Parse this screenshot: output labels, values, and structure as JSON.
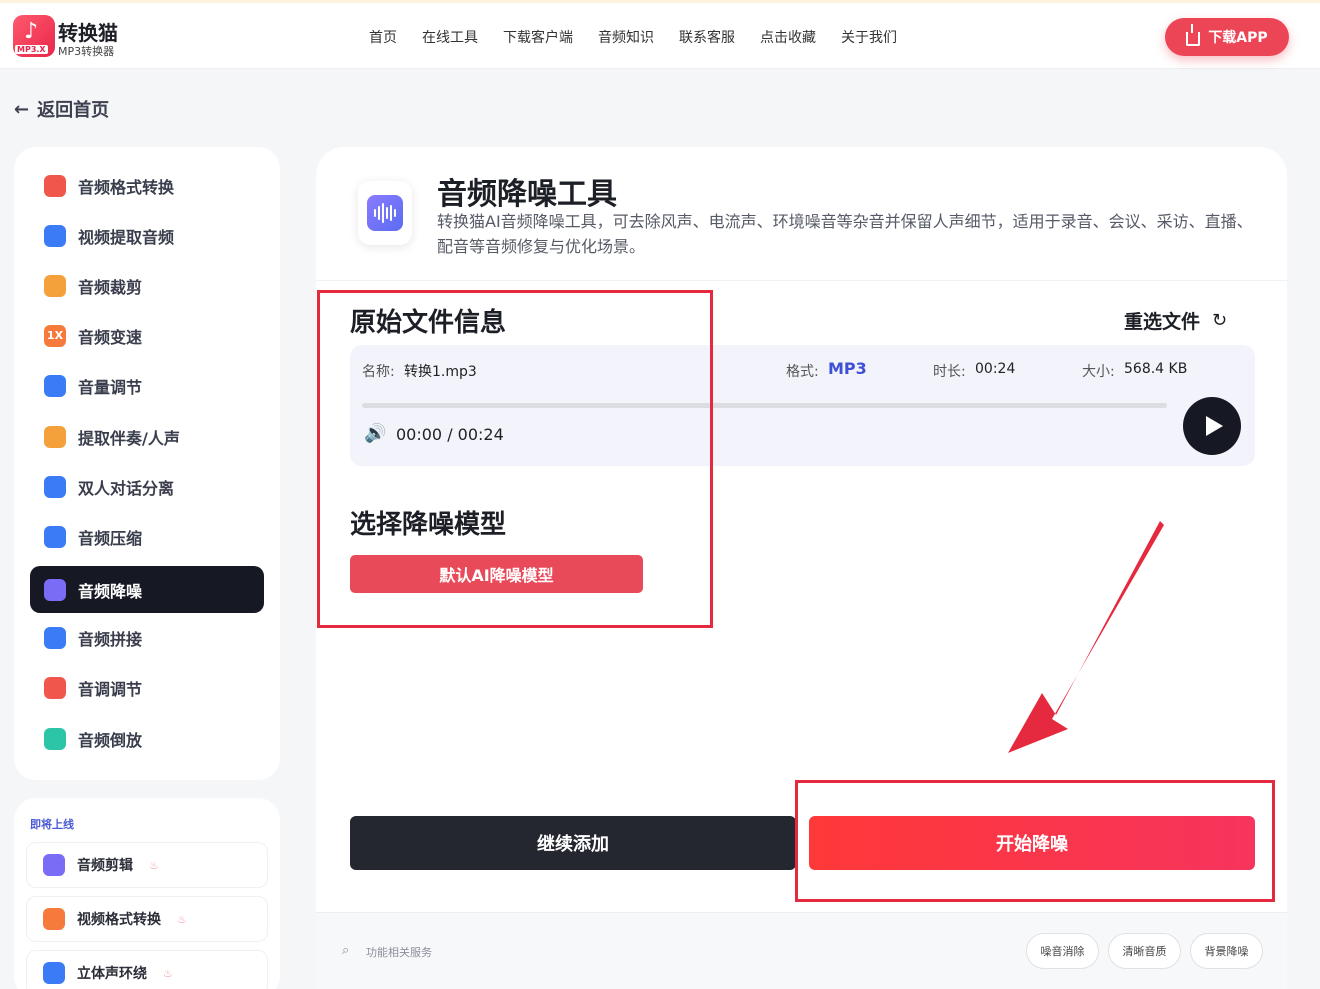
{
  "header": {
    "logo_title": "转换猫",
    "logo_subtitle": "MP3转换器",
    "logo_tag": "MP3.X",
    "nav": [
      "首页",
      "在线工具",
      "下载客户端",
      "音频知识",
      "联系客服",
      "点击收藏",
      "关于我们"
    ],
    "download_label": "下载APP"
  },
  "back_label": "返回首页",
  "sidebar": {
    "items": [
      {
        "label": "音频格式转换",
        "icon": "format-convert-icon",
        "color": "#f0564b"
      },
      {
        "label": "视频提取音频",
        "icon": "video-extract-icon",
        "color": "#3b7bf5"
      },
      {
        "label": "音频裁剪",
        "icon": "audio-cut-icon",
        "color": "#f5a13b"
      },
      {
        "label": "音频变速",
        "icon": "speed-icon",
        "color": "#f57a3b",
        "glyph": "1X"
      },
      {
        "label": "音量调节",
        "icon": "volume-icon",
        "color": "#3b7bf5"
      },
      {
        "label": "提取伴奏/人声",
        "icon": "vocal-extract-icon",
        "color": "#f5a13b"
      },
      {
        "label": "双人对话分离",
        "icon": "dialog-separate-icon",
        "color": "#3b7bf5"
      },
      {
        "label": "音频压缩",
        "icon": "compress-icon",
        "color": "#3b7bf5"
      },
      {
        "label": "音频降噪",
        "icon": "denoise-icon",
        "color": "#7b6cf6",
        "active": true
      },
      {
        "label": "音频拼接",
        "icon": "merge-icon",
        "color": "#3b7bf5"
      },
      {
        "label": "音调调节",
        "icon": "pitch-icon",
        "color": "#f0564b"
      },
      {
        "label": "音频倒放",
        "icon": "reverse-icon",
        "color": "#2cc5a8"
      }
    ]
  },
  "coming_soon": {
    "title": "即将上线",
    "items": [
      {
        "label": "音频剪辑",
        "icon": "scissors-icon",
        "color": "#7b6cf6"
      },
      {
        "label": "视频格式转换",
        "icon": "video-play-icon",
        "color": "#f57a3b"
      },
      {
        "label": "立体声环绕",
        "icon": "stereo-cube-icon",
        "color": "#3b7bf5"
      }
    ]
  },
  "tool": {
    "title": "音频降噪工具",
    "description": "转换猫AI音频降噪工具，可去除风声、电流声、环境噪音等杂音并保留人声细节，适用于录音、会议、采访、直播、配音等音频修复与优化场景。"
  },
  "file_info": {
    "section_title": "原始文件信息",
    "reselect_label": "重选文件",
    "name_label": "名称:",
    "name_value": "转换1.mp3",
    "format_label": "格式:",
    "format_value": "MP3",
    "duration_label": "时长:",
    "duration_value": "00:24",
    "size_label": "大小:",
    "size_value": "568.4 KB",
    "playback_time": "00:00 / 00:24",
    "progress": 0
  },
  "model": {
    "section_title": "选择降噪模型",
    "selected": "默认AI降噪模型"
  },
  "actions": {
    "continue_label": "继续添加",
    "start_label": "开始降噪"
  },
  "footer": {
    "search_label": "功能相关服务",
    "chips": [
      "噪音消除",
      "清晰音质",
      "背景降噪"
    ]
  },
  "colors": {
    "accent": "#ec4656",
    "annotation": "#e5293e",
    "dark": "#161923"
  }
}
